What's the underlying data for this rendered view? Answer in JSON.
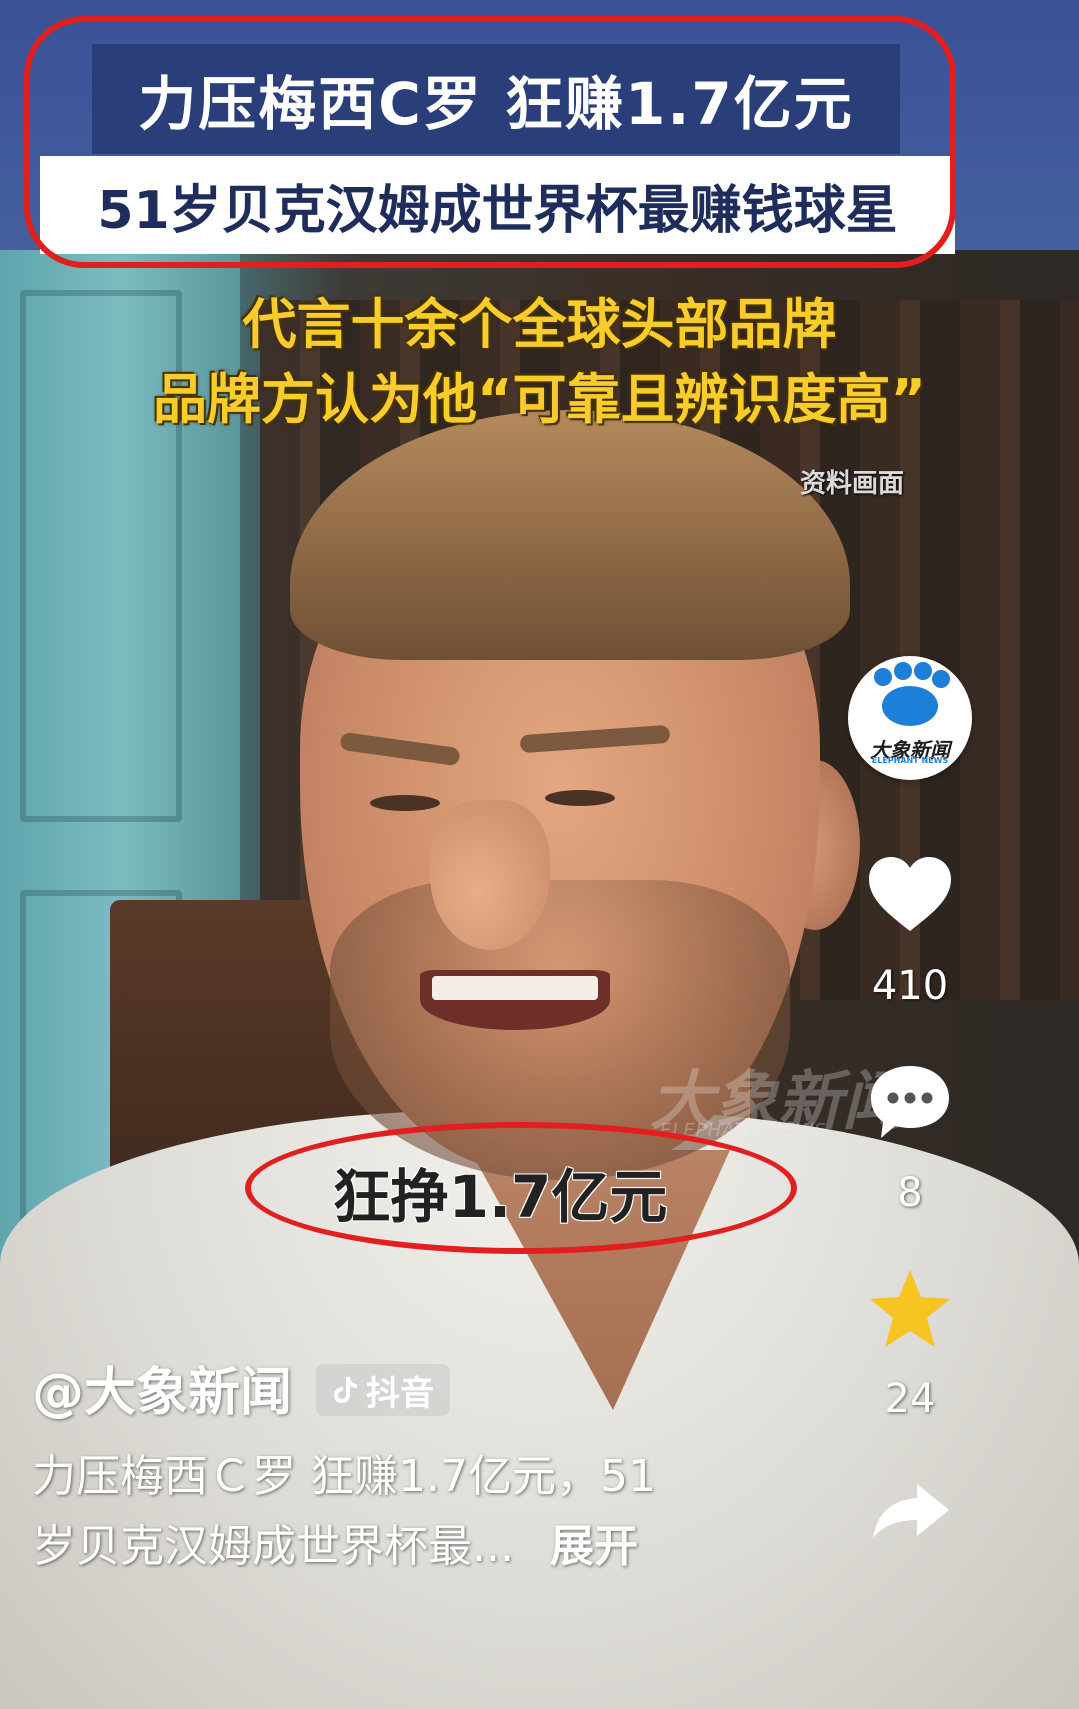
{
  "overlay": {
    "headline": "力压梅西C罗 狂赚1.7亿元",
    "subheadline": "51岁贝克汉姆成世界杯最赚钱球星",
    "caption_lines": [
      "代言十余个全球头部品牌",
      "品牌方认为他“可靠且辨识度高”"
    ],
    "source_tag": "资料画面",
    "watermark": "大象新闻",
    "watermark_sub": "ELEPHANT NEWS",
    "subtitle": "狂挣1.7亿元"
  },
  "rail": {
    "avatar_label": "大象新闻",
    "avatar_sublabel": "ELEPHANT NEWS",
    "likes": "410",
    "comments": "8",
    "favorites": "24"
  },
  "post": {
    "author": "@大象新闻",
    "platform": "抖音",
    "desc_line1": "力压梅西Ｃ罗 狂赚1.7亿元，51",
    "desc_line2": "岁贝克汉姆成世界杯最...",
    "expand": "展开"
  },
  "colors": {
    "highlight": "#e11f1f",
    "caption": "#f8cc2a",
    "headline_bg": "#2a3e7a",
    "brand_blue": "#1e7fd8",
    "favorite": "#f6c522"
  },
  "icons": [
    "heart-icon",
    "comment-icon",
    "star-icon",
    "share-icon",
    "tiktok-icon"
  ]
}
